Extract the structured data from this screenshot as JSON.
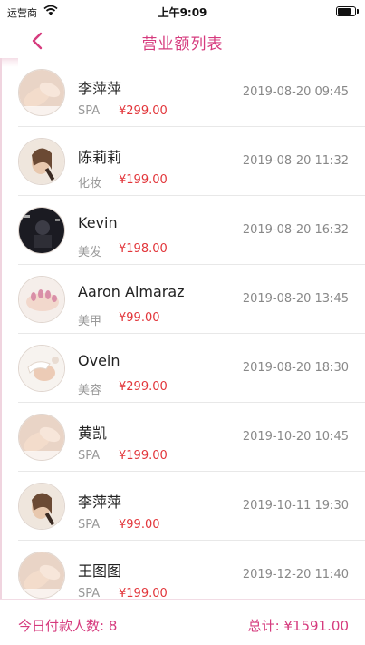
{
  "status_bar": {
    "carrier": "运营商",
    "time": "上午9:09"
  },
  "nav": {
    "title": "营业额列表",
    "back_icon": "chevron-left-icon"
  },
  "records": [
    {
      "name": "李萍萍",
      "category": "SPA",
      "amount": "¥299.00",
      "date": "2019-08-20 09:45",
      "avatar": "hand-massage"
    },
    {
      "name": "陈莉莉",
      "category": "化妆",
      "amount": "¥199.00",
      "date": "2019-08-20 11:32",
      "avatar": "makeup-face"
    },
    {
      "name": "Kevin",
      "category": "美发",
      "amount": "¥198.00",
      "date": "2019-08-20 16:32",
      "avatar": "hair-salon"
    },
    {
      "name": "Aaron Almaraz",
      "category": "美甲",
      "amount": "¥99.00",
      "date": "2019-08-20 13:45",
      "avatar": "nails"
    },
    {
      "name": "Ovein",
      "category": "美容",
      "amount": "¥299.00",
      "date": "2019-08-20 18:30",
      "avatar": "facial"
    },
    {
      "name": "黄凯",
      "category": "SPA",
      "amount": "¥199.00",
      "date": "2019-10-20 10:45",
      "avatar": "hand-massage"
    },
    {
      "name": "李萍萍",
      "category": "SPA",
      "amount": "¥99.00",
      "date": "2019-10-11 19:30",
      "avatar": "makeup-face"
    },
    {
      "name": "王图图",
      "category": "SPA",
      "amount": "¥199.00",
      "date": "2019-12-20 11:40",
      "avatar": "hand-massage"
    }
  ],
  "footer": {
    "today_count": "今日付款人数: 8",
    "total": "总计: ¥1591.00"
  },
  "colors": {
    "accent": "#d63b7e",
    "price": "#e2353a",
    "muted": "#999999"
  }
}
